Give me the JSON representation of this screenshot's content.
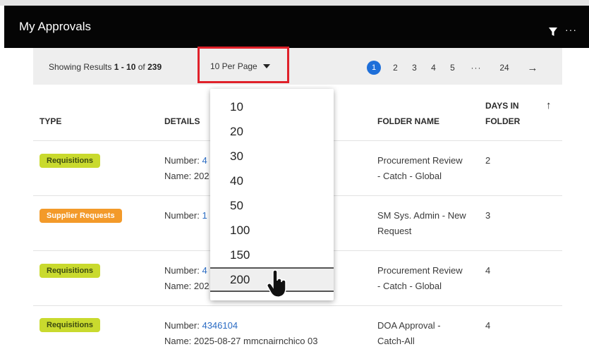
{
  "header": {
    "title": "My Approvals",
    "filter_icon": "filter-icon",
    "more_icon": "more-icon",
    "more_label": "···"
  },
  "toolbar": {
    "results_prefix": "Showing Results ",
    "results_range": "1 - 10",
    "results_of": " of ",
    "results_total": "239",
    "per_page_label": "10 Per Page"
  },
  "pagination": {
    "current": "1",
    "pages": [
      "2",
      "3",
      "4",
      "5"
    ],
    "ellipsis": "···",
    "last": "24",
    "next": "→"
  },
  "table": {
    "columns": {
      "type": "TYPE",
      "details": "DETAILS",
      "folder": "FOLDER NAME",
      "days_line1": "DAYS IN",
      "days_line2": "FOLDER"
    },
    "sort_icon": "↑",
    "rows": [
      {
        "type": "Requisitions",
        "type_color": "#c9da2e",
        "number_label": "Number: ",
        "number": "4",
        "name_label": "Name: 202",
        "folder_l1": "Procurement Review",
        "folder_l2": "- Catch - Global",
        "days": "2"
      },
      {
        "type": "Supplier Requests",
        "type_color": "#f39a2a",
        "number_label": "Number: ",
        "number": "1",
        "name_label": "",
        "folder_l1": "SM Sys. Admin - New",
        "folder_l2": "Request",
        "days": "3"
      },
      {
        "type": "Requisitions",
        "type_color": "#c9da2e",
        "number_label": "Number: ",
        "number": "4",
        "name_label": "Name: 202",
        "folder_l1": "Procurement Review",
        "folder_l2": "- Catch - Global",
        "days": "4"
      },
      {
        "type": "Requisitions",
        "type_color": "#c9da2e",
        "number_label": "Number: ",
        "number": "4346104",
        "name_label": "Name: 2025-08-27 mmcnairnchico 03",
        "folder_l1": "DOA Approval -",
        "folder_l2": "Catch-All",
        "days": "4"
      }
    ]
  },
  "dropdown": {
    "options": [
      "10",
      "20",
      "30",
      "40",
      "50",
      "100",
      "150",
      "200"
    ],
    "hovered": "200"
  },
  "colors": {
    "accent": "#1e6fd9",
    "highlight_border": "#e0212a",
    "header_bg": "#050505"
  }
}
